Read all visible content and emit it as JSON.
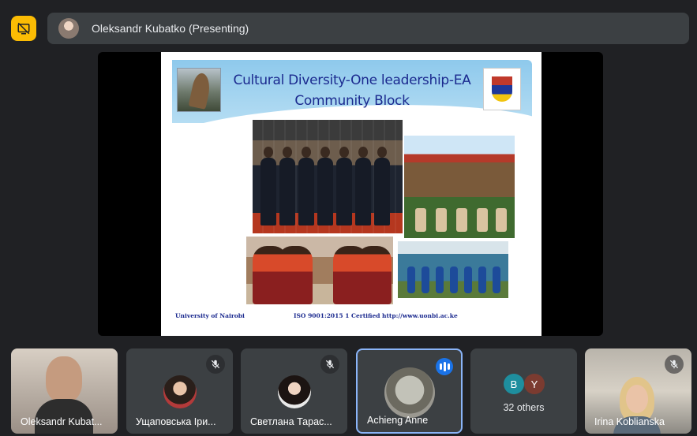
{
  "presenting_bar": {
    "presenter_label": "Oleksandr Kubatko (Presenting)"
  },
  "slide": {
    "title_line1": "Cultural Diversity-One leadership-EA",
    "title_line2": "Community Block",
    "footer_university": "University of Nairobi",
    "footer_iso": "ISO 9001:2015     1 Certified",
    "footer_url": "http://www.uonbi.ac.ke"
  },
  "participants": [
    {
      "name": "Oleksandr Kubat...",
      "muted": false
    },
    {
      "name": "Ущаповська Іри...",
      "muted": true
    },
    {
      "name": "Светлана Тарас...",
      "muted": true
    },
    {
      "name": "Achieng Anne",
      "muted": false,
      "speaking": true
    },
    {
      "name": "Irina Koblianska",
      "muted": true
    }
  ],
  "others": {
    "initials": [
      "B",
      "Y"
    ],
    "label": "32 others"
  },
  "colors": {
    "background": "#202124",
    "tile": "#3c4043",
    "present_toggle": "#fbbc04",
    "speaking_accent": "#1a73e8",
    "active_border": "#8ab4f8",
    "slide_title": "#1b2a8f"
  },
  "icons": {
    "present_toggle": "stop-presenting-icon",
    "mic_off": "mic-off-icon",
    "speaking": "audio-level-icon"
  }
}
